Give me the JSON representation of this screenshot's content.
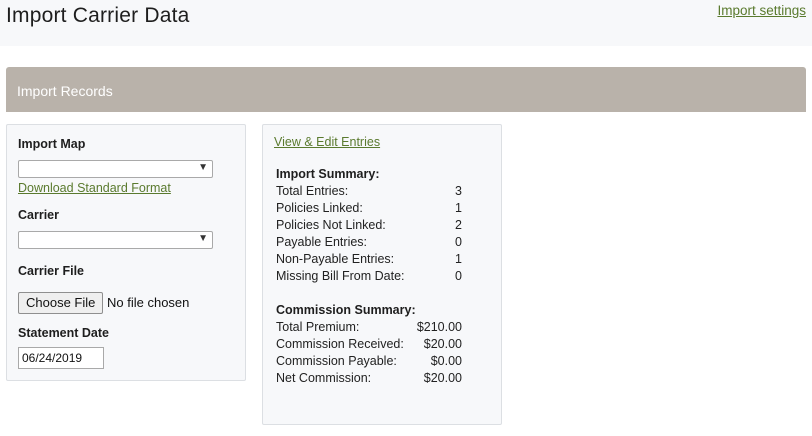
{
  "header": {
    "title": "Import Carrier Data",
    "settings_link": "Import settings"
  },
  "section": {
    "title": "Import Records"
  },
  "form": {
    "import_map_label": "Import Map",
    "import_map_value": "",
    "download_link": "Download Standard Format",
    "carrier_label": "Carrier",
    "carrier_value": "",
    "carrier_file_label": "Carrier File",
    "choose_file_button": "Choose File",
    "file_status": "No file chosen",
    "statement_date_label": "Statement Date",
    "statement_date_value": "06/24/2019"
  },
  "summary": {
    "view_edit_link": "View & Edit Entries",
    "import_title": "Import Summary:",
    "import_rows": [
      {
        "label": "Total Entries:",
        "value": "3"
      },
      {
        "label": "Policies Linked:",
        "value": "1"
      },
      {
        "label": "Policies Not Linked:",
        "value": "2"
      },
      {
        "label": "Payable Entries:",
        "value": "0"
      },
      {
        "label": "Non-Payable Entries:",
        "value": "1"
      },
      {
        "label": "Missing Bill From Date:",
        "value": "0"
      }
    ],
    "commission_title": "Commission Summary:",
    "commission_rows": [
      {
        "label": "Total Premium:",
        "value": "$210.00"
      },
      {
        "label": "Commission Received:",
        "value": "$20.00"
      },
      {
        "label": "Commission Payable:",
        "value": "$0.00"
      },
      {
        "label": "Net Commission:",
        "value": "$20.00"
      }
    ]
  },
  "colors": {
    "link": "#5a7a2e",
    "section_header": "#b9b2aa",
    "panel_bg": "#f7f8fa"
  }
}
